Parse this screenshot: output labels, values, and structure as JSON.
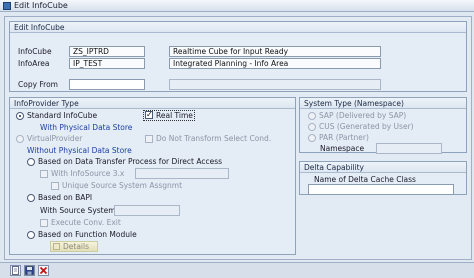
{
  "window": {
    "title": "Edit InfoCube"
  },
  "edit_infocube": {
    "group_title": "Edit InfoCube",
    "infocube_label": "InfoCube",
    "infocube_value": "ZS_IPTRD",
    "infocube_desc": "Realtime Cube for Input Ready",
    "infoarea_label": "InfoArea",
    "infoarea_value": "IP_TEST",
    "infoarea_desc": "Integrated Planning - Info Area",
    "copy_from_label": "Copy From",
    "copy_from_value": "",
    "copy_from_desc": ""
  },
  "infoprovider_type": {
    "group_title": "InfoProvider Type",
    "standard_infocube": "Standard InfoCube",
    "standard_selected": true,
    "real_time": "Real Time",
    "real_time_checked": true,
    "with_physical_data_store": "With Physical Data Store",
    "virtual_provider": "VirtualProvider",
    "do_not_transform": "Do Not Transform Select Cond.",
    "without_physical_data_store": "Without Physical Data Store",
    "based_on_dtp": "Based on Data Transfer Process for Direct Access",
    "with_infosource": "With InfoSource 3.x",
    "unique_source_system": "Unique Source System Assgnmt",
    "based_on_bapi": "Based on BAPI",
    "with_source_system": "With Source System",
    "execute_conv_exit": "Execute Conv. Exit",
    "based_on_function_module": "Based on Function Module",
    "details": "Details"
  },
  "system_type": {
    "group_title": "System Type (Namespace)",
    "sap": "SAP (Delivered by SAP)",
    "cus": "CUS (Generated by User)",
    "par": "PAR (Partner)",
    "namespace_label": "Namespace"
  },
  "delta_capability": {
    "group_title": "Delta Capability",
    "delta_cache_label": "Name of Delta Cache Class"
  },
  "toolbar": {
    "icons": [
      "create-icon",
      "save-icon",
      "cancel-icon"
    ]
  }
}
